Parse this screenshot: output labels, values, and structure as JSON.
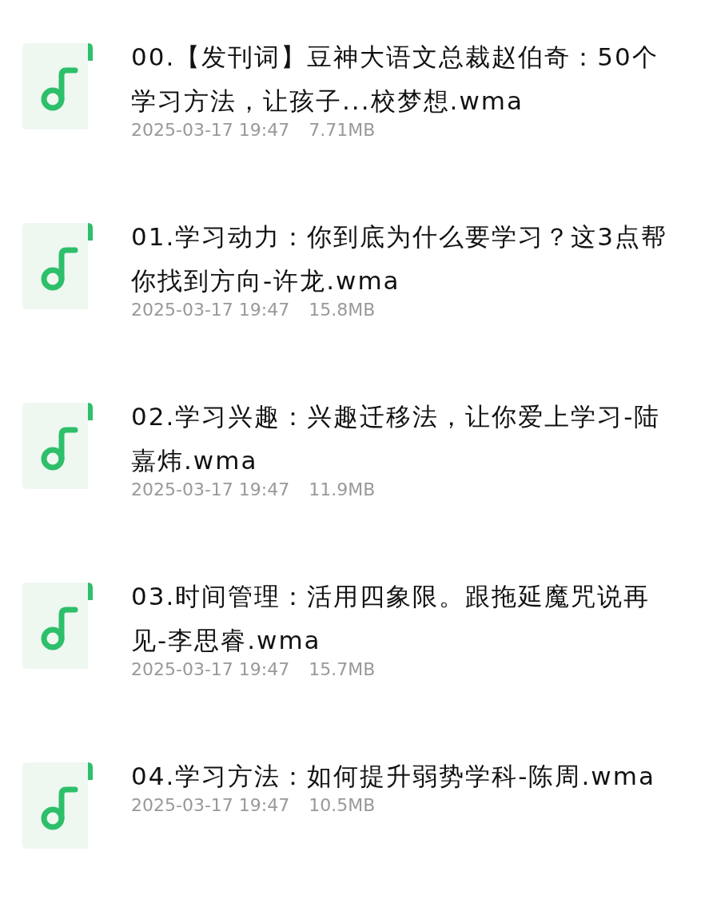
{
  "files": [
    {
      "name": "00.【发刊词】豆神大语文总裁赵伯奇：50个学习方法，让孩子...校梦想.wma",
      "date": "2025-03-17 19:47",
      "size": "7.71MB"
    },
    {
      "name": "01.学习动力：你到底为什么要学习？这3点帮你找到方向-许龙.wma",
      "date": "2025-03-17 19:47",
      "size": "15.8MB"
    },
    {
      "name": "02.学习兴趣：兴趣迁移法，让你爱上学习-陆嘉炜.wma",
      "date": "2025-03-17 19:47",
      "size": "11.9MB"
    },
    {
      "name": "03.时间管理：活用四象限。跟拖延魔咒说再见-李思睿.wma",
      "date": "2025-03-17 19:47",
      "size": "15.7MB"
    },
    {
      "name": "04.学习方法：如何提升弱势学科-陈周.wma",
      "date": "2025-03-17 19:47",
      "size": "10.5MB"
    }
  ]
}
